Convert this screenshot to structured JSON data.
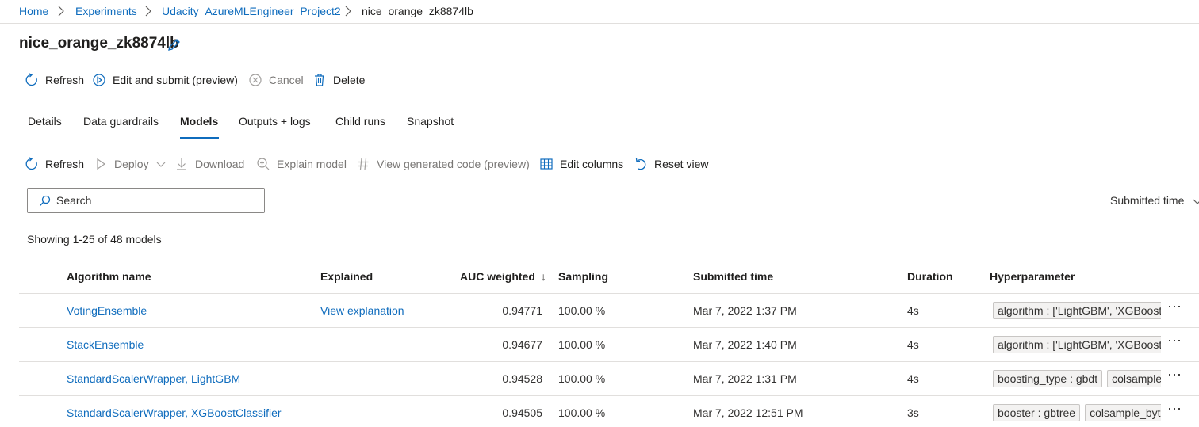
{
  "breadcrumb": {
    "items": [
      "Home",
      "Experiments",
      "Udacity_AzureMLEngineer_Project2",
      "nice_orange_zk8874lb"
    ]
  },
  "run": {
    "title": "nice_orange_zk8874lb"
  },
  "run_toolbar": {
    "refresh": "Refresh",
    "edit_submit": "Edit and submit (preview)",
    "cancel": "Cancel",
    "delete": "Delete"
  },
  "tabs": [
    "Details",
    "Data guardrails",
    "Models",
    "Outputs + logs",
    "Child runs",
    "Snapshot"
  ],
  "active_tab": "Models",
  "models_toolbar": {
    "refresh": "Refresh",
    "deploy": "Deploy",
    "download": "Download",
    "explain": "Explain model",
    "view_code": "View generated code (preview)",
    "edit_columns": "Edit columns",
    "reset_view": "Reset view"
  },
  "search": {
    "placeholder": "Search",
    "value": ""
  },
  "sort": {
    "label": "Submitted time"
  },
  "count_text": "Showing 1-25 of 48 models",
  "table": {
    "columns": [
      "Algorithm name",
      "Explained",
      "AUC weighted",
      "Sampling",
      "Submitted time",
      "Duration",
      "Hyperparameter"
    ],
    "sort_indicator": "↓",
    "rows": [
      {
        "algorithm": "VotingEnsemble",
        "explained": "View explanation",
        "auc": "0.94771",
        "sampling": "100.00 %",
        "submitted": "Mar 7, 2022 1:37 PM",
        "duration": "4s",
        "hyperparameters": [
          "algorithm : ['LightGBM', 'XGBoostC"
        ]
      },
      {
        "algorithm": "StackEnsemble",
        "explained": "",
        "auc": "0.94677",
        "sampling": "100.00 %",
        "submitted": "Mar 7, 2022 1:40 PM",
        "duration": "4s",
        "hyperparameters": [
          "algorithm : ['LightGBM', 'XGBoostC"
        ]
      },
      {
        "algorithm": "StandardScalerWrapper, LightGBM",
        "explained": "",
        "auc": "0.94528",
        "sampling": "100.00 %",
        "submitted": "Mar 7, 2022 1:31 PM",
        "duration": "4s",
        "hyperparameters": [
          "boosting_type : gbdt",
          "colsample_"
        ]
      },
      {
        "algorithm": "StandardScalerWrapper, XGBoostClassifier",
        "explained": "",
        "auc": "0.94505",
        "sampling": "100.00 %",
        "submitted": "Mar 7, 2022 12:51 PM",
        "duration": "3s",
        "hyperparameters": [
          "booster : gbtree",
          "colsample_bytre"
        ]
      }
    ]
  },
  "colors": {
    "link": "#0f6cbd",
    "text": "#201f1e",
    "disabled": "#797775",
    "border": "#e1dfdd"
  }
}
